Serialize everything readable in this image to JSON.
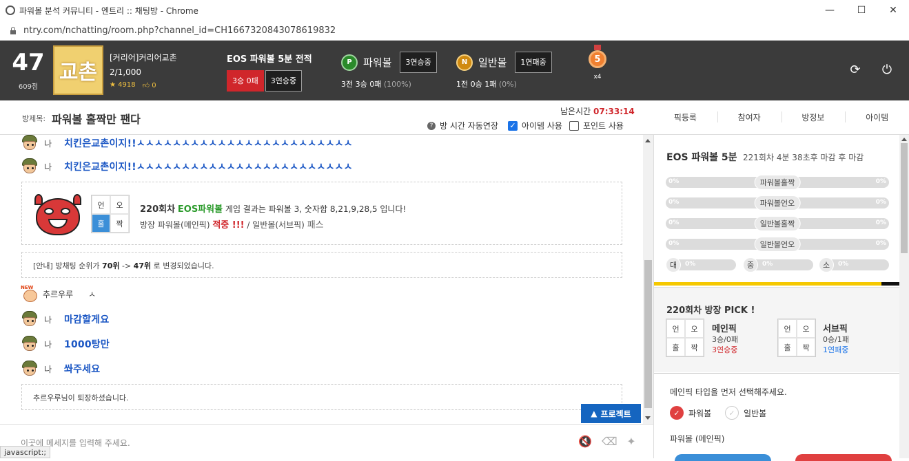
{
  "window": {
    "title": "파워볼 분석 커뮤니티 - 엔트리 :: 채팅방 - Chrome",
    "url": "ntry.com/nchatting/room.php?channel_id=CH1667320843078619832"
  },
  "header": {
    "rank": "47",
    "rank_points": "609점",
    "avatar_text": "교촌",
    "user_name": "[커리어]커리어교촌",
    "user_count": "2/1,000",
    "stars": "4918",
    "likes": "0",
    "eos_title": "EOS 파워볼 5분 전적",
    "eos_record": "3승 0패",
    "eos_streak": "3연승중",
    "powerball_coin": "P",
    "powerball_name": "파워볼",
    "powerball_streak": "3연승중",
    "powerball_line": "3전 3승 0패",
    "powerball_pct": "(100%)",
    "normalball_coin": "N",
    "normalball_name": "일반볼",
    "normalball_streak": "1연패중",
    "normalball_line": "1전 0승 1패",
    "normalball_pct": "(0%)",
    "medal_num": "5",
    "medal_count": "x4",
    "refresh_icon": "⟳",
    "power_icon": "⏻"
  },
  "room": {
    "label": "방제목:",
    "title": "파워볼 홀짝만 팬다",
    "time_label": "남은시간",
    "time_value": "07:33:14",
    "auto_extend": "방 시간 자동연장",
    "item_use": "아이템 사용",
    "point_use": "포인트 사용",
    "tabs": [
      "픽등록",
      "참여자",
      "방정보",
      "아이템"
    ]
  },
  "chat": {
    "me": "나",
    "msg1": "치킨은교촌이지!!ㅅㅅㅅㅅㅅㅅㅅㅅㅅㅅㅅㅅㅅㅅㅅㅅㅅㅅㅅㅅㅅㅅㅅㅅ",
    "msg2": "치킨은교촌이지!!ㅅㅅㅅㅅㅅㅅㅅㅅㅅㅅㅅㅅㅅㅅㅅㅅㅅㅅㅅㅅㅅㅅㅅㅅ",
    "result_grid": [
      "언",
      "오",
      "홀",
      "짝"
    ],
    "result_round": "220회차",
    "result_game": "EOS파워볼",
    "result_text": "게임 결과는 파워볼 3, 숫자합 8,21,9,28,5 입니다!",
    "result_line2a": "방장 파워볼(메인픽)",
    "result_hit": "적중 !!!",
    "result_line2b": "/ 일반볼(서브픽)",
    "result_pass": "패스",
    "notice_a": "[안내] 방채팅 순위가",
    "notice_from": "70위",
    "notice_arrow": "->",
    "notice_to": "47위",
    "notice_b": "로 변경되었습니다.",
    "new_tag": "NEW",
    "other_user": "추르우루",
    "other_msg": "ㅅ",
    "msg3": "마감할게요",
    "msg4": "1000탕만",
    "msg5": "쏴주세요",
    "leave": "추르우루님이 퇴장하셨습니다.",
    "project_btn": "프로젝트"
  },
  "input": {
    "placeholder": "이곳에 메세지를 입력해 주세요.",
    "mute_icon": "🔇",
    "eraser_icon": "⌫",
    "wand_icon": "✦"
  },
  "status_text": "javascript:;",
  "panel": {
    "game_title": "EOS 파워볼 5분",
    "round_info": "221회차 4분 38초후 마감 후 마감",
    "bars": [
      {
        "label": "파워볼홀짝",
        "left": "0%",
        "right": "0%"
      },
      {
        "label": "파워볼언오",
        "left": "0%",
        "right": "0%"
      },
      {
        "label": "일반볼홀짝",
        "left": "0%",
        "right": "0%"
      },
      {
        "label": "일반볼언오",
        "left": "0%",
        "right": "0%"
      }
    ],
    "size_bars": [
      {
        "label": "대",
        "pct": "0%"
      },
      {
        "label": "중",
        "pct": "0%"
      },
      {
        "label": "소",
        "pct": "0%"
      }
    ],
    "pick_head": "220회차 방장 PICK !",
    "main_pick": "메인픽",
    "main_record": "3승/0패",
    "main_streak": "3연승중",
    "sub_pick": "서브픽",
    "sub_record": "0승/1패",
    "sub_streak": "1연패중",
    "grid": [
      "언",
      "오",
      "홀",
      "짝"
    ],
    "instruction": "메인픽 타입을 먼저 선택해주세요.",
    "opt_powerball": "파워볼",
    "opt_normal": "일반볼",
    "sub_label": "파워볼 (메인픽)"
  }
}
